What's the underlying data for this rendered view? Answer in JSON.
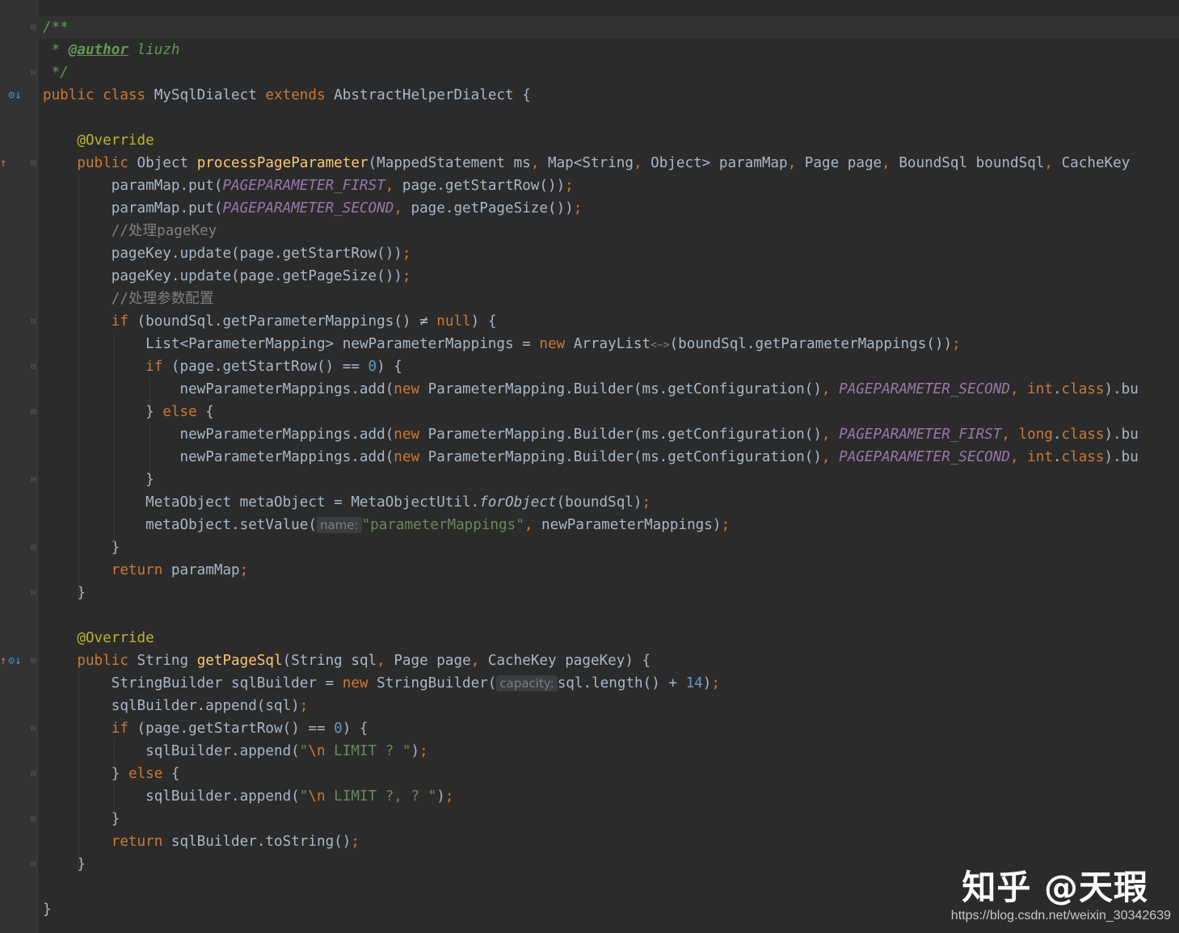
{
  "code_lines": [
    [
      {
        "t": "/**",
        "c": "doc"
      }
    ],
    [
      {
        "t": " * ",
        "c": "doc"
      },
      {
        "t": "@author",
        "c": "doctag"
      },
      {
        "t": " liuzh",
        "c": "doc"
      }
    ],
    [
      {
        "t": " */",
        "c": "doc"
      }
    ],
    [
      {
        "t": "public ",
        "c": "kw"
      },
      {
        "t": "class ",
        "c": "kw"
      },
      {
        "t": "MySqlDialect "
      },
      {
        "t": "extends ",
        "c": "kw"
      },
      {
        "t": "AbstractHelperDialect {"
      }
    ],
    [],
    [
      {
        "t": "    "
      },
      {
        "t": "@Override",
        "c": "ann"
      }
    ],
    [
      {
        "t": "    "
      },
      {
        "t": "public ",
        "c": "kw"
      },
      {
        "t": "Object "
      },
      {
        "t": "processPageParameter",
        "c": "fn"
      },
      {
        "t": "(MappedStatement ms"
      },
      {
        "t": ", ",
        "c": "kw"
      },
      {
        "t": "Map<String"
      },
      {
        "t": ", ",
        "c": "kw"
      },
      {
        "t": "Object> paramMap"
      },
      {
        "t": ", ",
        "c": "kw"
      },
      {
        "t": "Page page"
      },
      {
        "t": ", ",
        "c": "kw"
      },
      {
        "t": "BoundSql boundSql"
      },
      {
        "t": ", ",
        "c": "kw"
      },
      {
        "t": "CacheKey"
      }
    ],
    [
      {
        "t": "        paramMap.put("
      },
      {
        "t": "PAGEPARAMETER_FIRST",
        "c": "cst"
      },
      {
        "t": ", ",
        "c": "kw"
      },
      {
        "t": "page.getStartRow())"
      },
      {
        "t": ";",
        "c": "kw"
      }
    ],
    [
      {
        "t": "        paramMap.put("
      },
      {
        "t": "PAGEPARAMETER_SECOND",
        "c": "cst"
      },
      {
        "t": ", ",
        "c": "kw"
      },
      {
        "t": "page.getPageSize())"
      },
      {
        "t": ";",
        "c": "kw"
      }
    ],
    [
      {
        "t": "        "
      },
      {
        "t": "//处理pageKey",
        "c": "cmt"
      }
    ],
    [
      {
        "t": "        pageKey.update(page.getStartRow())"
      },
      {
        "t": ";",
        "c": "kw"
      }
    ],
    [
      {
        "t": "        pageKey.update(page.getPageSize())"
      },
      {
        "t": ";",
        "c": "kw"
      }
    ],
    [
      {
        "t": "        "
      },
      {
        "t": "//处理参数配置",
        "c": "cmt"
      }
    ],
    [
      {
        "t": "        "
      },
      {
        "t": "if ",
        "c": "kw"
      },
      {
        "t": "(boundSql.getParameterMappings() ≠ "
      },
      {
        "t": "null",
        "c": "kw"
      },
      {
        "t": ") {"
      }
    ],
    [
      {
        "t": "            List<ParameterMapping> newParameterMappings = "
      },
      {
        "t": "new ",
        "c": "kw"
      },
      {
        "t": "ArrayList"
      },
      {
        "t": "<~>",
        "c": "diamond"
      },
      {
        "t": "(boundSql.getParameterMappings())"
      },
      {
        "t": ";",
        "c": "kw"
      }
    ],
    [
      {
        "t": "            "
      },
      {
        "t": "if ",
        "c": "kw"
      },
      {
        "t": "(page.getStartRow() == "
      },
      {
        "t": "0",
        "c": "num"
      },
      {
        "t": ") {"
      }
    ],
    [
      {
        "t": "                newParameterMappings.add("
      },
      {
        "t": "new ",
        "c": "kw"
      },
      {
        "t": "ParameterMapping.Builder(ms.getConfiguration()"
      },
      {
        "t": ", ",
        "c": "kw"
      },
      {
        "t": "PAGEPARAMETER_SECOND",
        "c": "cst"
      },
      {
        "t": ", ",
        "c": "kw"
      },
      {
        "t": "int",
        "c": "kw"
      },
      {
        "t": "."
      },
      {
        "t": "class",
        "c": "kw"
      },
      {
        "t": ").bu"
      }
    ],
    [
      {
        "t": "            } "
      },
      {
        "t": "else ",
        "c": "kw"
      },
      {
        "t": "{"
      }
    ],
    [
      {
        "t": "                newParameterMappings.add("
      },
      {
        "t": "new ",
        "c": "kw"
      },
      {
        "t": "ParameterMapping.Builder(ms.getConfiguration()"
      },
      {
        "t": ", ",
        "c": "kw"
      },
      {
        "t": "PAGEPARAMETER_FIRST",
        "c": "cst"
      },
      {
        "t": ", ",
        "c": "kw"
      },
      {
        "t": "long",
        "c": "kw"
      },
      {
        "t": "."
      },
      {
        "t": "class",
        "c": "kw"
      },
      {
        "t": ").bu"
      }
    ],
    [
      {
        "t": "                newParameterMappings.add("
      },
      {
        "t": "new ",
        "c": "kw"
      },
      {
        "t": "ParameterMapping.Builder(ms.getConfiguration()"
      },
      {
        "t": ", ",
        "c": "kw"
      },
      {
        "t": "PAGEPARAMETER_SECOND",
        "c": "cst"
      },
      {
        "t": ", ",
        "c": "kw"
      },
      {
        "t": "int",
        "c": "kw"
      },
      {
        "t": "."
      },
      {
        "t": "class",
        "c": "kw"
      },
      {
        "t": ").bu"
      }
    ],
    [
      {
        "t": "            }"
      }
    ],
    [
      {
        "t": "            MetaObject metaObject = MetaObjectUtil."
      },
      {
        "t": "forObject",
        "c": "ital"
      },
      {
        "t": "(boundSql)"
      },
      {
        "t": ";",
        "c": "kw"
      }
    ],
    [
      {
        "t": "            metaObject.setValue("
      },
      {
        "t": "name:",
        "c": "hint"
      },
      {
        "t": "\"parameterMappings\"",
        "c": "str"
      },
      {
        "t": ", ",
        "c": "kw"
      },
      {
        "t": "newParameterMappings)"
      },
      {
        "t": ";",
        "c": "kw"
      }
    ],
    [
      {
        "t": "        }"
      }
    ],
    [
      {
        "t": "        "
      },
      {
        "t": "return ",
        "c": "kw"
      },
      {
        "t": "paramMap"
      },
      {
        "t": ";",
        "c": "kw"
      }
    ],
    [
      {
        "t": "    }"
      }
    ],
    [],
    [
      {
        "t": "    "
      },
      {
        "t": "@Override",
        "c": "ann"
      }
    ],
    [
      {
        "t": "    "
      },
      {
        "t": "public ",
        "c": "kw"
      },
      {
        "t": "String "
      },
      {
        "t": "getPageSql",
        "c": "fn"
      },
      {
        "t": "(String sql"
      },
      {
        "t": ", ",
        "c": "kw"
      },
      {
        "t": "Page page"
      },
      {
        "t": ", ",
        "c": "kw"
      },
      {
        "t": "CacheKey pageKey) {"
      }
    ],
    [
      {
        "t": "        StringBuilder sqlBuilder = "
      },
      {
        "t": "new ",
        "c": "kw"
      },
      {
        "t": "StringBuilder("
      },
      {
        "t": "capacity:",
        "c": "hint"
      },
      {
        "t": "sql.length() + "
      },
      {
        "t": "14",
        "c": "num"
      },
      {
        "t": ")"
      },
      {
        "t": ";",
        "c": "kw"
      }
    ],
    [
      {
        "t": "        sqlBuilder.append(sql)"
      },
      {
        "t": ";",
        "c": "kw"
      }
    ],
    [
      {
        "t": "        "
      },
      {
        "t": "if ",
        "c": "kw"
      },
      {
        "t": "(page.getStartRow() == "
      },
      {
        "t": "0",
        "c": "num"
      },
      {
        "t": ") {"
      }
    ],
    [
      {
        "t": "            sqlBuilder.append("
      },
      {
        "t": "\"",
        "c": "str"
      },
      {
        "t": "\\n",
        "c": "kw"
      },
      {
        "t": " LIMIT ? \"",
        "c": "str"
      },
      {
        "t": ")"
      },
      {
        "t": ";",
        "c": "kw"
      }
    ],
    [
      {
        "t": "        } "
      },
      {
        "t": "else ",
        "c": "kw"
      },
      {
        "t": "{"
      }
    ],
    [
      {
        "t": "            sqlBuilder.append("
      },
      {
        "t": "\"",
        "c": "str"
      },
      {
        "t": "\\n",
        "c": "kw"
      },
      {
        "t": " LIMIT ?, ? \"",
        "c": "str"
      },
      {
        "t": ")"
      },
      {
        "t": ";",
        "c": "kw"
      }
    ],
    [
      {
        "t": "        }"
      }
    ],
    [
      {
        "t": "        "
      },
      {
        "t": "return ",
        "c": "kw"
      },
      {
        "t": "sqlBuilder.toString()"
      },
      {
        "t": ";",
        "c": "kw"
      }
    ],
    [
      {
        "t": "    }"
      }
    ],
    [],
    [
      {
        "t": "}"
      }
    ]
  ],
  "watermark": "知乎 @天瑕",
  "source_url": "https://blog.csdn.net/weixin_30342639",
  "colors": {
    "background": "#2b2b2b",
    "keyword": "#cc7832",
    "annotation": "#bbb529",
    "method": "#ffc66d",
    "constant": "#9876aa",
    "string": "#6a8759",
    "number": "#6897bb"
  }
}
